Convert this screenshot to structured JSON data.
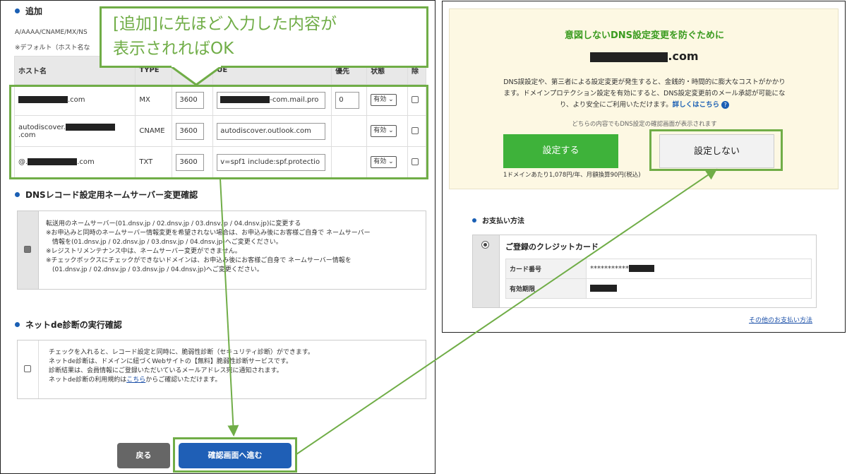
{
  "left": {
    "add_section": {
      "title": "追加",
      "types_line": "A/AAAA/CNAME/MX/NS",
      "default_note": "※デフォルト（ホスト名な"
    },
    "table": {
      "headers": {
        "host": "ホスト名",
        "type": "TYPE",
        "value": "UE",
        "priority": "優先",
        "status": "状態",
        "delete": "除"
      },
      "rows": [
        {
          "host_suffix": ".com",
          "type": "MX",
          "ttl": "3600",
          "value_suffix": "-com.mail.pro",
          "priority": "0",
          "status": "有効"
        },
        {
          "host_prefix": "autodiscover.",
          "host_suffix": ".com",
          "type": "CNAME",
          "ttl": "3600",
          "value": "autodiscover.outlook.com",
          "status": "有効"
        },
        {
          "host_prefix": "@.",
          "host_suffix": ".com",
          "type": "TXT",
          "ttl": "3600",
          "value": "v=spf1 include:spf.protectio",
          "status": "有効"
        }
      ]
    },
    "ns_section": {
      "title": "DNSレコード設定用ネームサーバー変更確認",
      "lines": [
        "転送用のネームサーバー(01.dnsv.jp / 02.dnsv.jp / 03.dnsv.jp / 04.dnsv.jp)に変更する",
        "※お申込みと同時のネームサーバー情報変更を希望されない場合は、お申込み後にお客様ご自身で ネームサーバー",
        "　情報を(01.dnsv.jp / 02.dnsv.jp / 03.dnsv.jp / 04.dnsv.jp)へご変更ください。",
        "※レジストリメンテナンス中は、ネームサーバー変更ができません。",
        "※チェックボックスにチェックができないドメインは、お申込み後にお客様ご自身で ネームサーバー情報を",
        "　(01.dnsv.jp / 02.dnsv.jp / 03.dnsv.jp / 04.dnsv.jp)へご変更ください。"
      ]
    },
    "diag_section": {
      "title": "ネットde診断の実行確認",
      "lines": [
        "チェックを入れると、レコード設定と同時に、脆弱性診断（セキュリティ診断）ができます。",
        "ネットde診断は、ドメインに紐づくWebサイトの【無料】脆弱性診断サービスです。",
        "診断結果は、会員情報にご登録いただいているメールアドレス宛に通知されます。"
      ],
      "last_line_before": "ネットde診断の利用規約は",
      "last_line_link": "こちら",
      "last_line_after": "からご確認いただけます。"
    },
    "buttons": {
      "back": "戻る",
      "next": "確認画面へ進む"
    }
  },
  "callout": {
    "line1": "[追加]に先ほど入力した内容が",
    "line2": "表示されればOK"
  },
  "right": {
    "title": "意図しないDNS設定変更を防ぐために",
    "domain_suffix": ".com",
    "desc_lines": [
      "DNS誤設定や、第三者による設定変更が発生すると、金銭的・時間的に膨大なコストがかかり",
      "ます。ドメインプロテクション設定を有効にすると、DNS設定変更前のメール承認が可能にな",
      "り、より安全にご利用いただけます。"
    ],
    "details_link": "詳しくはこちら",
    "note": "どちらの内容でもDNS設定の確認画面が表示されます",
    "btn_enable": "設定する",
    "btn_disable": "設定しない",
    "price": "1ドメインあたり1,078円/年、月額換算90円(税込)",
    "payment": {
      "title": "お支払い方法",
      "card_title": "ご登録のクレジットカード",
      "card_number_label": "カード番号",
      "card_number_value": "***********",
      "expiry_label": "有効期限",
      "other_link": "その他のお支払い方法"
    }
  },
  "colors": {
    "accent_green": "#70ad47",
    "button_green": "#3eb23a",
    "button_blue": "#1f5fb6",
    "banner_bg": "#fdf8e3",
    "title_green": "#3a9b1f"
  }
}
